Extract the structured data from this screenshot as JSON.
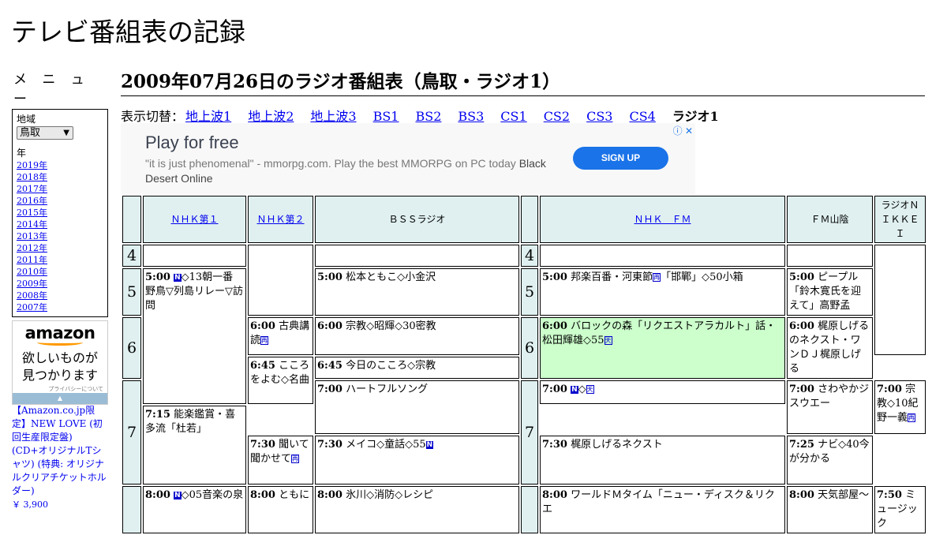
{
  "site_title": "テレビ番組表の記録",
  "menu": {
    "heading": "メ ニ ュ ー",
    "region_label": "地域",
    "region_value": "鳥取",
    "year_label": "年",
    "years": [
      "2019年",
      "2018年",
      "2017年",
      "2016年",
      "2015年",
      "2014年",
      "2013年",
      "2012年",
      "2011年",
      "2010年",
      "2009年",
      "2008年",
      "2007年"
    ]
  },
  "amazon_ad": {
    "logo": "amazon",
    "tagline1": "欲しいものが",
    "tagline2": "見つかります",
    "privacy": "プライバシーについて",
    "product": "【Amazon.co.jp限定】NEW LOVE (初回生産限定盤) (CD+オリジナルTシャツ) (特典: オリジナルクリアチケットホルダー)",
    "price": "￥ 3,900"
  },
  "page_heading": "2009年07月26日のラジオ番組表（鳥取・ラジオ1）",
  "switcher": {
    "label": "表示切替：",
    "links": [
      "地上波1",
      "地上波2",
      "地上波3",
      "BS1",
      "BS2",
      "BS3",
      "CS1",
      "CS2",
      "CS3",
      "CS4"
    ],
    "current": "ラジオ1"
  },
  "banner_ad": {
    "headline": "Play for free",
    "body": "\"it is just phenomenal\" - mmorpg.com. Play the best MMORPG on PC today",
    "body_highlight": "Black Desert Online",
    "cta": "SIGN UP"
  },
  "channels": [
    "ＮＨＫ第１",
    "ＮＨＫ第２",
    "ＢＳＳラジオ",
    "ＮＨＫ　ＦＭ",
    "ＦＭ山陰",
    "ラジオＮＩＫＫＥＩ"
  ],
  "hours": [
    "4",
    "5",
    "6",
    "7"
  ],
  "programs": {
    "nhk1_500": {
      "time": "5:00",
      "icon": "N",
      "title": "◇13朝一番 野鳥▽列島リレー▽訪問"
    },
    "nhk1_800": {
      "time": "8:00",
      "icon": "N",
      "title": "◇05音楽の泉"
    },
    "nhk2_600": {
      "time": "6:00",
      "title": "古典講読",
      "icon": "再"
    },
    "nhk2_645": {
      "time": "6:45",
      "title": "こころをよむ◇名曲"
    },
    "nhk2_730": {
      "time": "7:30",
      "title": "聞いて聞かせて",
      "icon": "再"
    },
    "nhk2_800": {
      "time": "8:00",
      "title": "ともに"
    },
    "bss_500": {
      "time": "5:00",
      "title": "松本ともこ◇小金沢"
    },
    "bss_600": {
      "time": "6:00",
      "title": "宗教◇昭輝◇30密教"
    },
    "bss_645": {
      "time": "6:45",
      "title": "今日のこころ◇宗教"
    },
    "bss_700": {
      "time": "7:00",
      "title": "ハートフルソング"
    },
    "bss_730": {
      "time": "7:30",
      "title": "メイコ◇童話◇55",
      "icon": "N"
    },
    "bss_800": {
      "time": "8:00",
      "title": "氷川◇消防◇レシピ"
    },
    "fm_500": {
      "time": "5:00",
      "title": "邦楽百番・河東節",
      "title2": "「邯鄲」◇50小箱",
      "icon": "再"
    },
    "fm_600": {
      "time": "6:00",
      "title": "バロックの森「リクエストアラカルト」話・松田輝雄◇55",
      "icon": "天"
    },
    "fm_700": {
      "time": "7:00",
      "icon": "N",
      "title": "◇",
      "icon2": "天"
    },
    "fm_715": {
      "time": "7:15",
      "title": "能楽鑑賞・喜多流「杜若」"
    },
    "fm_800": {
      "time": "8:00",
      "title": "ワールドＭタイム「ニュー・ディスク＆リクエ"
    },
    "fmsan_500": {
      "time": "5:00",
      "title": "ピープル「鈴木寛氏を迎えて」高野孟"
    },
    "fmsan_600": {
      "time": "6:00",
      "title": "梶原しげるのネクスト・ワンＤＪ梶原しげる"
    },
    "fmsan_700": {
      "time": "7:00",
      "title": "さわやかジスウエー"
    },
    "fmsan_730": {
      "time": "7:30",
      "title": "梶原しげるネクスト"
    },
    "fmsan_800": {
      "time": "8:00",
      "title": "天気部屋～"
    },
    "nikkei_700": {
      "time": "7:00",
      "title": "宗教◇10紀野一義",
      "icon": "再"
    },
    "nikkei_725": {
      "time": "7:25",
      "title": "ナビ◇40今が分かる"
    },
    "nikkei_750": {
      "time": "7:50",
      "title": "ミュージック"
    }
  }
}
